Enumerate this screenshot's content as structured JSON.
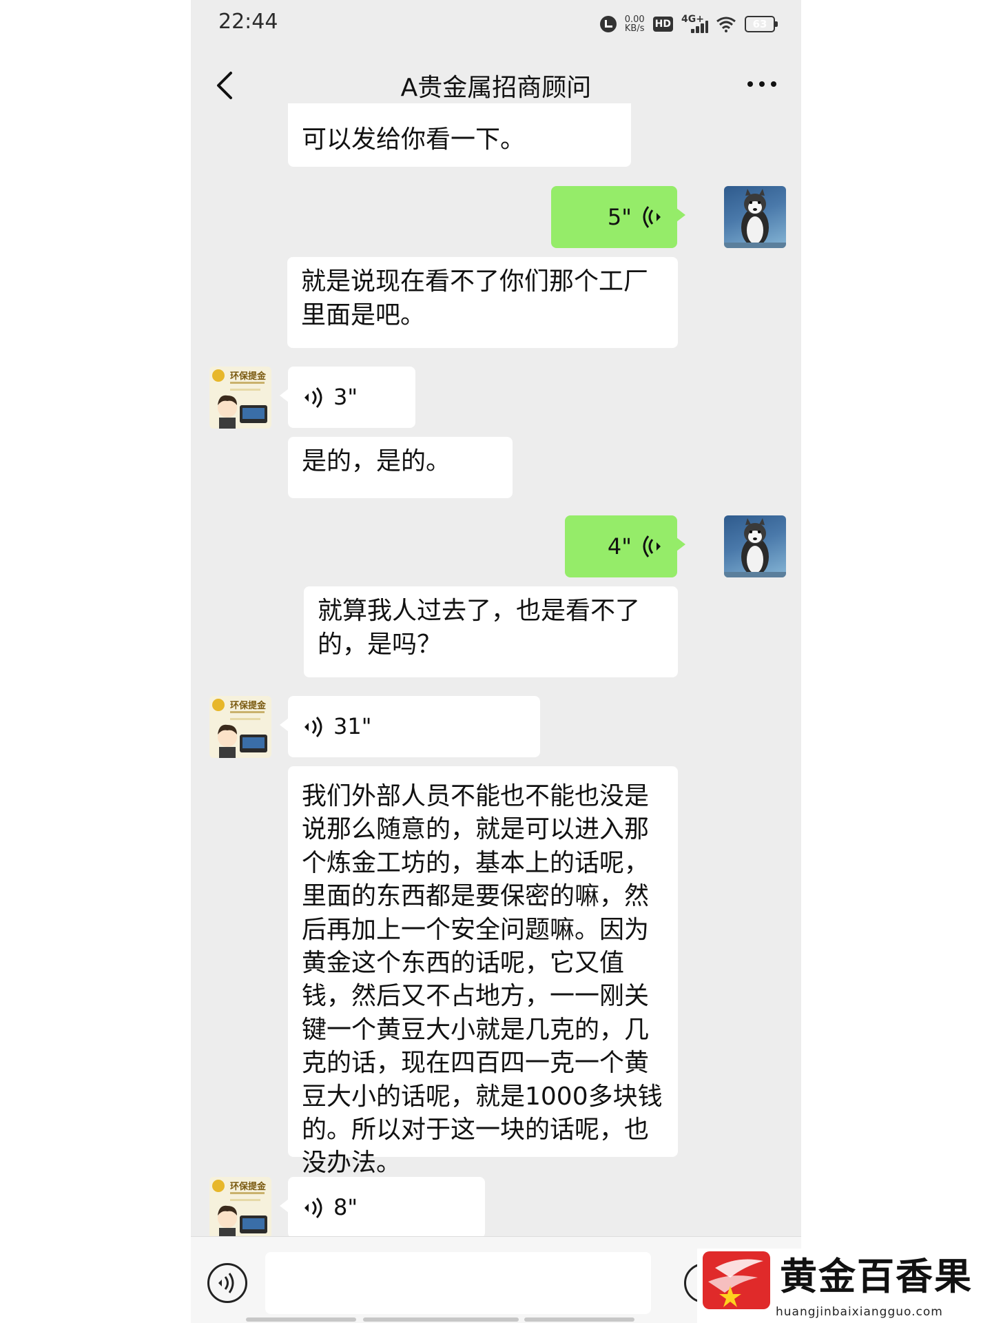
{
  "status_bar": {
    "time": "22:44",
    "speed_value": "0.00",
    "speed_unit": "KB/s",
    "hd_label": "HD",
    "network_label": "4G+",
    "battery_level": "63"
  },
  "nav": {
    "title": "A贵金属招商顾问",
    "back_icon": "chevron-left-icon",
    "more_icon": "more-dots-icon"
  },
  "messages": [
    {
      "from": "them",
      "type": "text",
      "text": "可以发给你看一下。"
    },
    {
      "from": "me",
      "type": "voice",
      "duration": "5\""
    },
    {
      "from": "them",
      "type": "text",
      "text": "就是说现在看不了你们那个工厂里面是吧。"
    },
    {
      "from": "them",
      "type": "voice",
      "duration": "3\""
    },
    {
      "from": "them",
      "type": "text",
      "text": "是的，是的。"
    },
    {
      "from": "me",
      "type": "voice",
      "duration": "4\""
    },
    {
      "from": "them",
      "type": "text",
      "text": "就算我人过去了，也是看不了的，是吗？"
    },
    {
      "from": "them",
      "type": "voice",
      "duration": "31\""
    },
    {
      "from": "them",
      "type": "text",
      "text": "我们外部人员不能也不能也没是说那么随意的，就是可以进入那个炼金工坊的，基本上的话呢，里面的东西都是要保密的嘛，然后再加上一个安全问题嘛。因为黄金这个东西的话呢，它又值钱，然后又不占地方，一一刚关键一个黄豆大小就是几克的，几克的话，现在四百四一克一个黄豆大小的话呢，就是1000多块钱的。所以对于这一块的话呢，也没办法。"
    },
    {
      "from": "them",
      "type": "voice",
      "duration": "8\""
    }
  ],
  "contact_avatar": {
    "brand_text": "环保提金"
  },
  "input_bar": {
    "placeholder": "",
    "voice_icon": "voice-toggle-icon",
    "emoji_icon": "emoji-icon"
  },
  "watermark": {
    "title": "黄金百香果",
    "url": "huangjinbaixiangguo.com"
  },
  "colors": {
    "background": "#ededed",
    "bubble_me": "#95ec69",
    "bubble_them": "#ffffff",
    "watermark_logo": "#e02a2a"
  }
}
